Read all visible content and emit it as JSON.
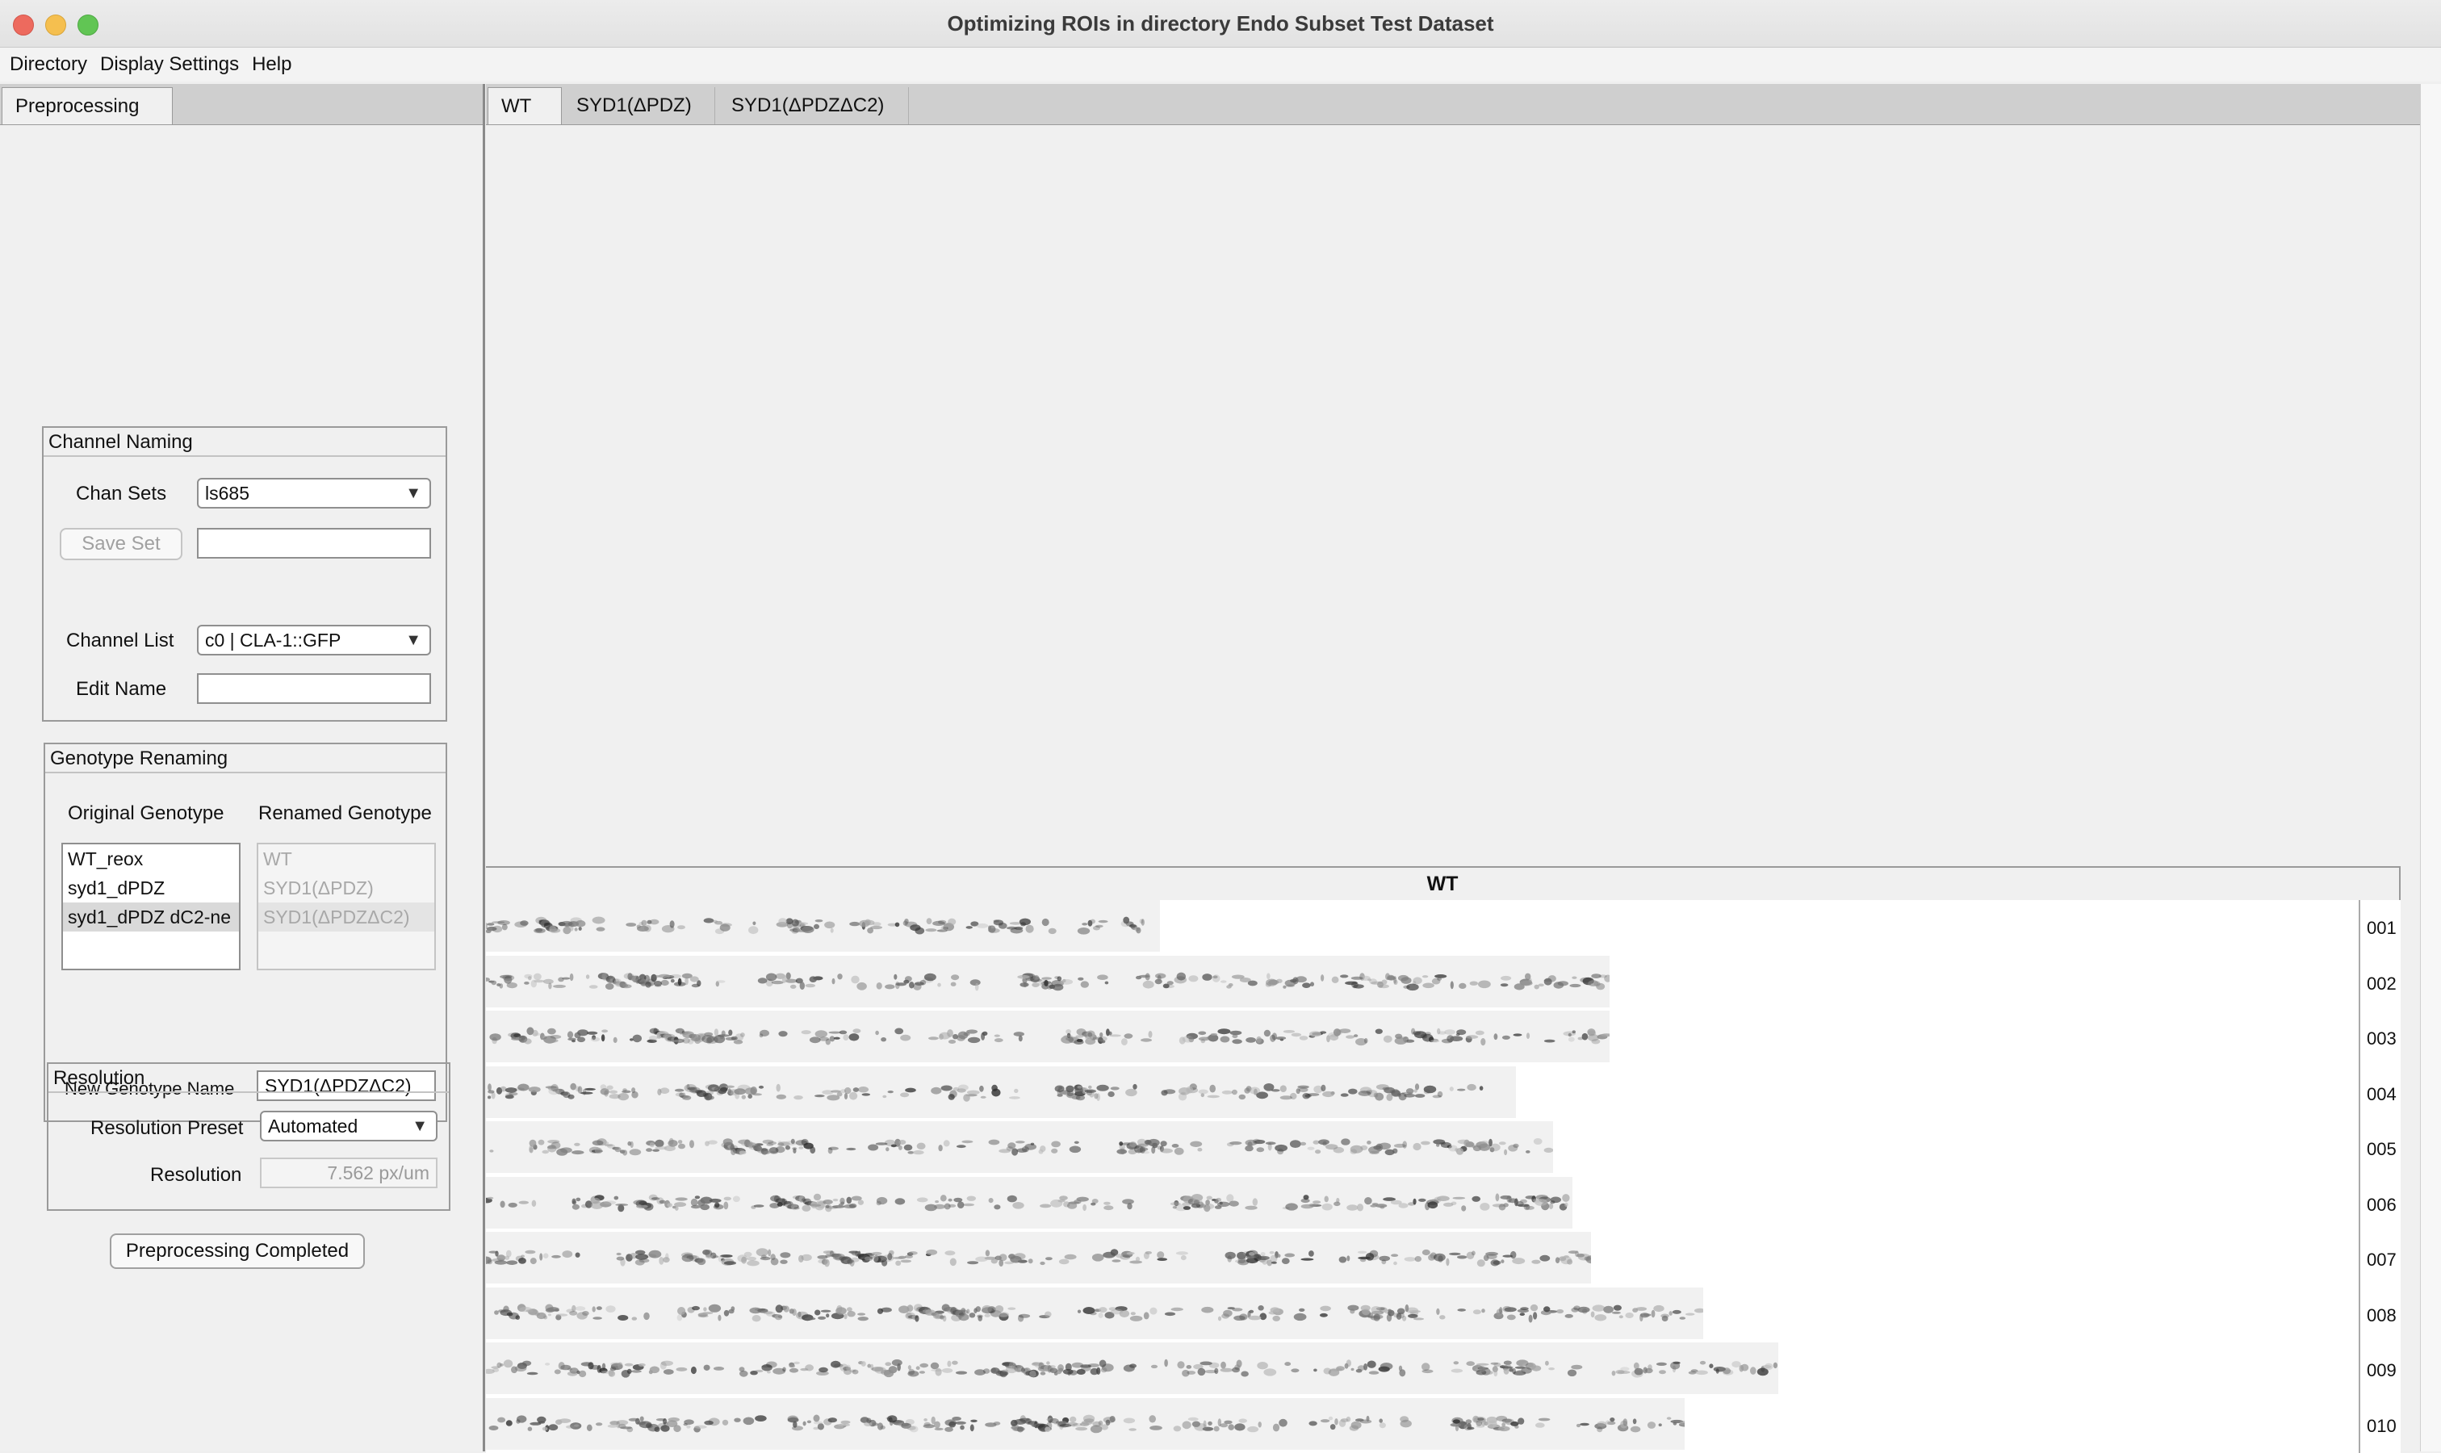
{
  "window": {
    "title": "Optimizing ROIs in directory Endo Subset Test Dataset"
  },
  "menu": [
    "Directory",
    "Display Settings",
    "Help"
  ],
  "left_tabs": [
    "Preprocessing"
  ],
  "channel_naming": {
    "title": "Channel Naming",
    "chan_sets_label": "Chan Sets",
    "chan_sets_value": "ls685",
    "save_set_label": "Save Set",
    "save_set_input": "",
    "channel_list_label": "Channel List",
    "channel_list_value": "c0 | CLA-1::GFP",
    "edit_name_label": "Edit Name",
    "edit_name_value": ""
  },
  "genotype_renaming": {
    "title": "Genotype Renaming",
    "original_header": "Original Genotype",
    "renamed_header": "Renamed Genotype",
    "original": [
      "WT_reox",
      "syd1_dPDZ",
      "syd1_dPDZ dC2-ne"
    ],
    "renamed": [
      "WT",
      "SYD1(ΔPDZ)",
      "SYD1(ΔPDZΔC2)"
    ],
    "selected_index": 2,
    "new_name_label": "New Genotype Name",
    "new_name_value": "SYD1(ΔPDZΔC2)"
  },
  "resolution": {
    "title": "Resolution",
    "preset_label": "Resolution Preset",
    "preset_value": "Automated",
    "resolution_label": "Resolution",
    "resolution_value": "7.562 px/um"
  },
  "preprocessing_button": "Preprocessing Completed",
  "right_tabs": [
    "WT",
    "SYD1(ΔPDZ)",
    "SYD1(ΔPDZΔC2)"
  ],
  "viewer": {
    "title": "WT",
    "rows": [
      {
        "label": "001",
        "length": 0.36
      },
      {
        "label": "002",
        "length": 0.6
      },
      {
        "label": "003",
        "length": 0.6
      },
      {
        "label": "004",
        "length": 0.55
      },
      {
        "label": "005",
        "length": 0.57
      },
      {
        "label": "006",
        "length": 0.58
      },
      {
        "label": "007",
        "length": 0.59
      },
      {
        "label": "008",
        "length": 0.65
      },
      {
        "label": "009",
        "length": 0.69
      },
      {
        "label": "010",
        "length": 0.64
      }
    ]
  }
}
